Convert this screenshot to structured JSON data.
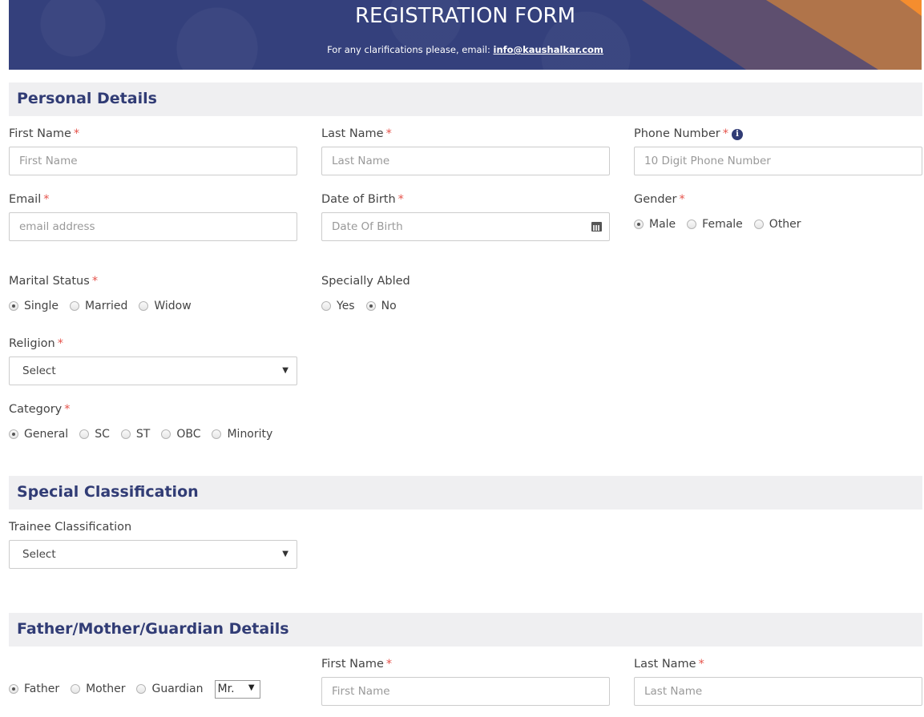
{
  "banner": {
    "title": "REGISTRATION FORM",
    "subtitle_prefix": "For any clarifications please, email:",
    "email": "info@kaushalkar.com"
  },
  "colors": {
    "brand_blue": "#34407c",
    "heading_text": "#313c75",
    "required_asterisk": "#e5534b",
    "accent_orange": "#f58d2e"
  },
  "sections": {
    "personal": {
      "title": "Personal Details",
      "first_name": {
        "label": "First Name",
        "required": "*",
        "placeholder": "First Name",
        "value": ""
      },
      "last_name": {
        "label": "Last Name",
        "required": "*",
        "placeholder": "Last Name",
        "value": ""
      },
      "phone": {
        "label": "Phone Number",
        "required": "*",
        "placeholder": "10 Digit Phone Number",
        "value": "",
        "info_icon": "info-circle-icon"
      },
      "email": {
        "label": "Email",
        "required": "*",
        "placeholder": "email address",
        "value": ""
      },
      "dob": {
        "label": "Date of Birth",
        "required": "*",
        "placeholder": "Date Of Birth",
        "value": "",
        "icon": "calendar-icon"
      },
      "gender": {
        "label": "Gender",
        "required": "*",
        "options": [
          "Male",
          "Female",
          "Other"
        ],
        "selected": "Male"
      },
      "marital_status": {
        "label": "Marital Status",
        "required": "*",
        "options": [
          "Single",
          "Married",
          "Widow"
        ],
        "selected": "Single"
      },
      "specially_abled": {
        "label": "Specially Abled",
        "options": [
          "Yes",
          "No"
        ],
        "selected": "No"
      },
      "religion": {
        "label": "Religion",
        "required": "*",
        "selected": "Select"
      },
      "category": {
        "label": "Category",
        "required": "*",
        "options": [
          "General",
          "SC",
          "ST",
          "OBC",
          "Minority"
        ],
        "selected": "General"
      }
    },
    "special": {
      "title": "Special Classification",
      "trainee_classification": {
        "label": "Trainee Classification",
        "selected": "Select"
      }
    },
    "guardian": {
      "title": "Father/Mother/Guardian Details",
      "relation": {
        "options": [
          "Father",
          "Mother",
          "Guardian"
        ],
        "selected": "Father"
      },
      "salutation": {
        "selected": "Mr."
      },
      "first_name": {
        "label": "First Name",
        "required": "*",
        "placeholder": "First Name",
        "value": ""
      },
      "last_name": {
        "label": "Last Name",
        "required": "*",
        "placeholder": "Last Name",
        "value": ""
      }
    }
  },
  "glyphs": {
    "select_arrow": "▼",
    "info": "i"
  }
}
